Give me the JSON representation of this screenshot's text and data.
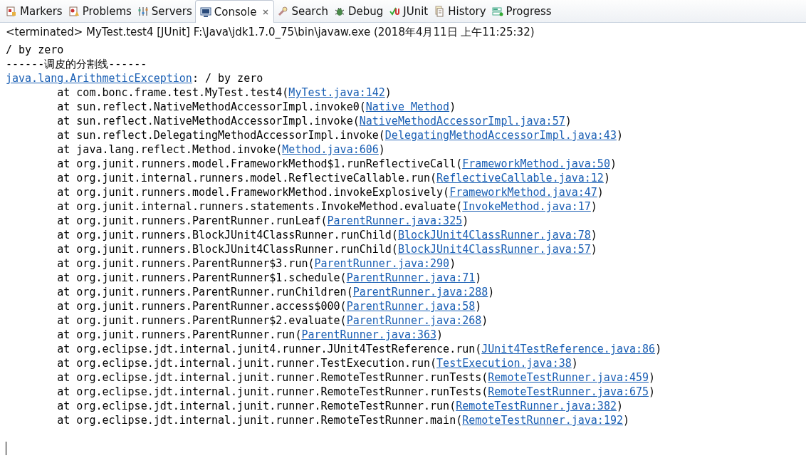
{
  "tabs": [
    {
      "label": "Markers",
      "kind": "markers",
      "selected": false,
      "closable": false
    },
    {
      "label": "Problems",
      "kind": "problems",
      "selected": false,
      "closable": false
    },
    {
      "label": "Servers",
      "kind": "servers",
      "selected": false,
      "closable": false
    },
    {
      "label": "Console",
      "kind": "console",
      "selected": true,
      "closable": true
    },
    {
      "label": "Search",
      "kind": "search",
      "selected": false,
      "closable": false
    },
    {
      "label": "Debug",
      "kind": "debug",
      "selected": false,
      "closable": false
    },
    {
      "label": "JUnit",
      "kind": "junit",
      "selected": false,
      "closable": false
    },
    {
      "label": "History",
      "kind": "history",
      "selected": false,
      "closable": false
    },
    {
      "label": "Progress",
      "kind": "progress",
      "selected": false,
      "closable": false
    }
  ],
  "console": {
    "title": "<terminated> MyTest.test4 [JUnit] F:\\Java\\jdk1.7.0_75\\bin\\javaw.exe (2018年4月11日 上午11:25:32)",
    "lines": [
      {
        "kind": "plain",
        "text": "/ by zero"
      },
      {
        "kind": "plain",
        "text": "------调皮的分割线------"
      },
      {
        "kind": "exception",
        "link": "java.lang.ArithmeticException",
        "text": ": / by zero"
      },
      {
        "kind": "frame",
        "text": "\tat com.bonc.frame.test.MyTest.test4(",
        "link": "MyTest.java:142",
        "end": ")"
      },
      {
        "kind": "frame",
        "text": "\tat sun.reflect.NativeMethodAccessorImpl.invoke0(",
        "link": "Native Method",
        "end": ")"
      },
      {
        "kind": "frame",
        "text": "\tat sun.reflect.NativeMethodAccessorImpl.invoke(",
        "link": "NativeMethodAccessorImpl.java:57",
        "end": ")"
      },
      {
        "kind": "frame",
        "text": "\tat sun.reflect.DelegatingMethodAccessorImpl.invoke(",
        "link": "DelegatingMethodAccessorImpl.java:43",
        "end": ")"
      },
      {
        "kind": "frame",
        "text": "\tat java.lang.reflect.Method.invoke(",
        "link": "Method.java:606",
        "end": ")"
      },
      {
        "kind": "frame",
        "text": "\tat org.junit.runners.model.FrameworkMethod$1.runReflectiveCall(",
        "link": "FrameworkMethod.java:50",
        "end": ")"
      },
      {
        "kind": "frame",
        "text": "\tat org.junit.internal.runners.model.ReflectiveCallable.run(",
        "link": "ReflectiveCallable.java:12",
        "end": ")"
      },
      {
        "kind": "frame",
        "text": "\tat org.junit.runners.model.FrameworkMethod.invokeExplosively(",
        "link": "FrameworkMethod.java:47",
        "end": ")"
      },
      {
        "kind": "frame",
        "text": "\tat org.junit.internal.runners.statements.InvokeMethod.evaluate(",
        "link": "InvokeMethod.java:17",
        "end": ")"
      },
      {
        "kind": "frame",
        "text": "\tat org.junit.runners.ParentRunner.runLeaf(",
        "link": "ParentRunner.java:325",
        "end": ")"
      },
      {
        "kind": "frame",
        "text": "\tat org.junit.runners.BlockJUnit4ClassRunner.runChild(",
        "link": "BlockJUnit4ClassRunner.java:78",
        "end": ")"
      },
      {
        "kind": "frame",
        "text": "\tat org.junit.runners.BlockJUnit4ClassRunner.runChild(",
        "link": "BlockJUnit4ClassRunner.java:57",
        "end": ")"
      },
      {
        "kind": "frame",
        "text": "\tat org.junit.runners.ParentRunner$3.run(",
        "link": "ParentRunner.java:290",
        "end": ")"
      },
      {
        "kind": "frame",
        "text": "\tat org.junit.runners.ParentRunner$1.schedule(",
        "link": "ParentRunner.java:71",
        "end": ")"
      },
      {
        "kind": "frame",
        "text": "\tat org.junit.runners.ParentRunner.runChildren(",
        "link": "ParentRunner.java:288",
        "end": ")"
      },
      {
        "kind": "frame",
        "text": "\tat org.junit.runners.ParentRunner.access$000(",
        "link": "ParentRunner.java:58",
        "end": ")"
      },
      {
        "kind": "frame",
        "text": "\tat org.junit.runners.ParentRunner$2.evaluate(",
        "link": "ParentRunner.java:268",
        "end": ")"
      },
      {
        "kind": "frame",
        "text": "\tat org.junit.runners.ParentRunner.run(",
        "link": "ParentRunner.java:363",
        "end": ")"
      },
      {
        "kind": "frame",
        "text": "\tat org.eclipse.jdt.internal.junit4.runner.JUnit4TestReference.run(",
        "link": "JUnit4TestReference.java:86",
        "end": ")"
      },
      {
        "kind": "frame",
        "text": "\tat org.eclipse.jdt.internal.junit.runner.TestExecution.run(",
        "link": "TestExecution.java:38",
        "end": ")"
      },
      {
        "kind": "frame",
        "text": "\tat org.eclipse.jdt.internal.junit.runner.RemoteTestRunner.runTests(",
        "link": "RemoteTestRunner.java:459",
        "end": ")"
      },
      {
        "kind": "frame",
        "text": "\tat org.eclipse.jdt.internal.junit.runner.RemoteTestRunner.runTests(",
        "link": "RemoteTestRunner.java:675",
        "end": ")"
      },
      {
        "kind": "frame",
        "text": "\tat org.eclipse.jdt.internal.junit.runner.RemoteTestRunner.run(",
        "link": "RemoteTestRunner.java:382",
        "end": ")"
      },
      {
        "kind": "frame",
        "text": "\tat org.eclipse.jdt.internal.junit.runner.RemoteTestRunner.main(",
        "link": "RemoteTestRunner.java:192",
        "end": ")"
      }
    ]
  }
}
